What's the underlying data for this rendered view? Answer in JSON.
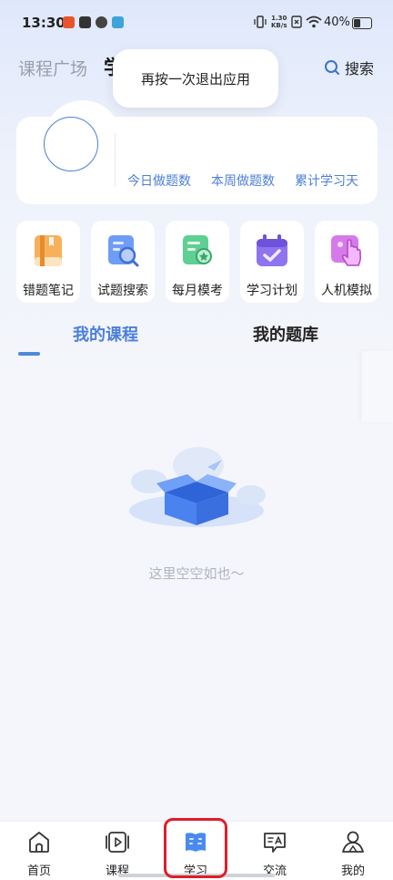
{
  "status_bar": {
    "time": "13:30",
    "net_speed": "1.30",
    "net_unit": "KB/s",
    "battery": "40%"
  },
  "header": {
    "tab_plaza": "课程广场",
    "tab_study": "学",
    "search_label": "搜索"
  },
  "toast": {
    "text": "再按一次退出应用"
  },
  "profile": {
    "stats": [
      "今日做题数",
      "本周做题数",
      "累计学习天"
    ]
  },
  "tools": [
    {
      "label": "错题笔记",
      "icon": "notebook-icon",
      "color": "#f5a34a"
    },
    {
      "label": "试题搜索",
      "icon": "search-doc-icon",
      "color": "#5b8ef0"
    },
    {
      "label": "每月模考",
      "icon": "exam-certificate-icon",
      "color": "#4cc585"
    },
    {
      "label": "学习计划",
      "icon": "calendar-check-icon",
      "color": "#8a6df0"
    },
    {
      "label": "人机模拟",
      "icon": "touch-hand-icon",
      "color": "#d46ae6"
    }
  ],
  "section_tabs": {
    "my_courses": "我的课程",
    "my_question_bank": "我的题库",
    "active_color": "#4c7fd8"
  },
  "empty_state": {
    "text": "这里空空如也～"
  },
  "bottom_nav": [
    {
      "label": "首页",
      "icon": "home-icon"
    },
    {
      "label": "课程",
      "icon": "course-play-icon"
    },
    {
      "label": "学习",
      "icon": "study-book-icon"
    },
    {
      "label": "交流",
      "icon": "chat-icon"
    },
    {
      "label": "我的",
      "icon": "profile-icon"
    }
  ]
}
